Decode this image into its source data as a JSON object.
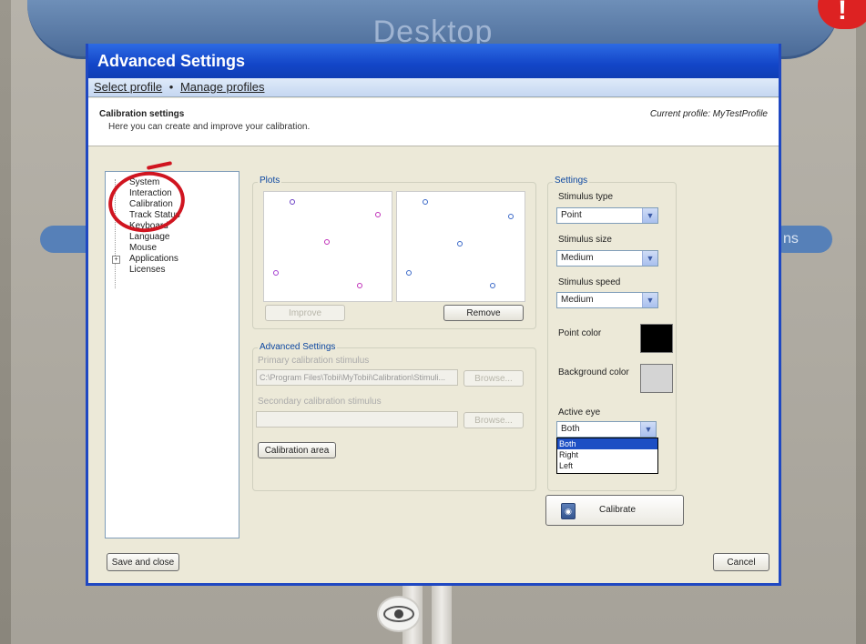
{
  "background": {
    "title": "Desktop",
    "pill_right_label": "ns",
    "badge": "!"
  },
  "dialog": {
    "title": "Advanced Settings",
    "menu": {
      "select_profile": "Select profile",
      "separator": "•",
      "manage_profiles": "Manage profiles"
    },
    "header": {
      "title": "Calibration settings",
      "description": "Here you can create and improve your calibration.",
      "current_profile": "Current profile: MyTestProfile"
    },
    "tree": {
      "items": [
        "System",
        "Interaction",
        "Calibration",
        "Track Status",
        "Keyboard",
        "Language",
        "Mouse",
        "Applications",
        "Licenses"
      ]
    },
    "plots": {
      "label": "Plots",
      "improve_label": "Improve",
      "remove_label": "Remove"
    },
    "advanced": {
      "label": "Advanced Settings",
      "primary_label": "Primary calibration stimulus",
      "primary_value": "C:\\Program Files\\Tobii\\MyTobii\\Calibration\\Stimuli...",
      "secondary_label": "Secondary calibration stimulus",
      "secondary_value": "",
      "browse_label": "Browse...",
      "calibration_area_label": "Calibration area"
    },
    "settings": {
      "label": "Settings",
      "stimulus_type_label": "Stimulus type",
      "stimulus_type_value": "Point",
      "stimulus_size_label": "Stimulus size",
      "stimulus_size_value": "Medium",
      "stimulus_speed_label": "Stimulus speed",
      "stimulus_speed_value": "Medium",
      "point_color_label": "Point color",
      "point_color": "#000000",
      "background_color_label": "Background color",
      "background_color": "#d4d4d4",
      "active_eye_label": "Active eye",
      "active_eye_value": "Both",
      "active_eye_options": [
        "Both",
        "Right",
        "Left"
      ]
    },
    "calibrate_label": "Calibrate",
    "save_close_label": "Save and close",
    "cancel_label": "Cancel"
  },
  "colors": {
    "titlebar": "#1346c8",
    "annotation_red": "#d01520",
    "selected_option": "#1d4fc4"
  }
}
